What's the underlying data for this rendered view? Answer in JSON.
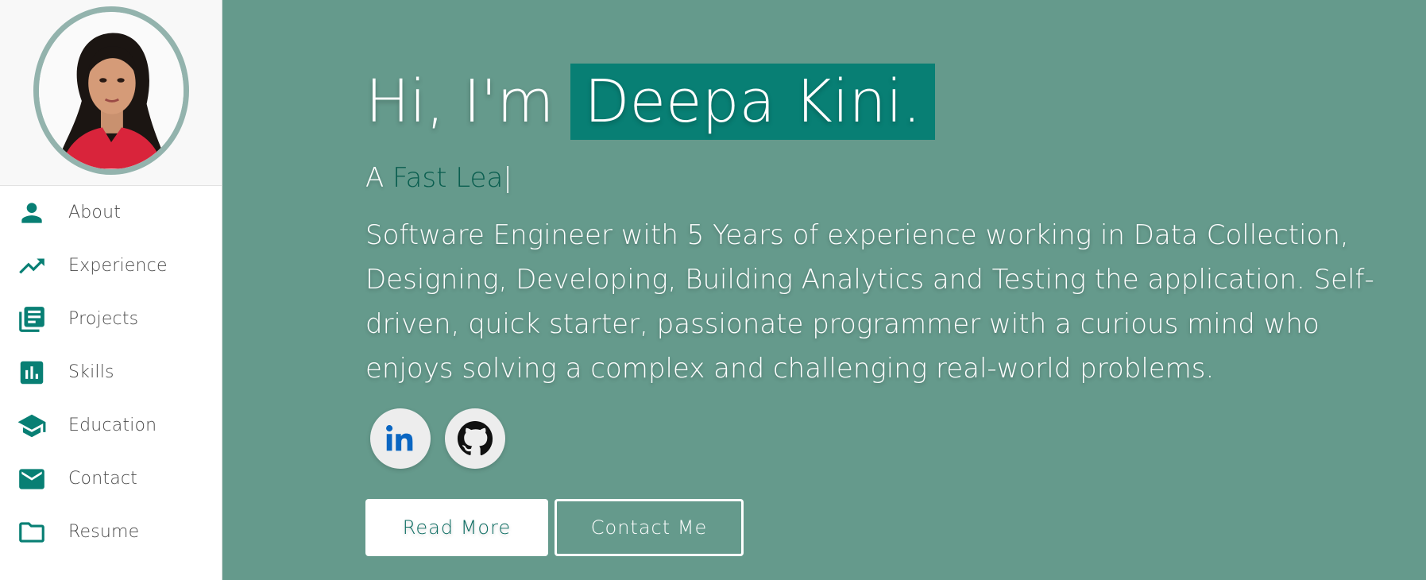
{
  "sidebar": {
    "avatar_alt": "profile photo",
    "items": [
      {
        "label": "About",
        "icon": "person-icon"
      },
      {
        "label": "Experience",
        "icon": "trending-up-icon"
      },
      {
        "label": "Projects",
        "icon": "library-books-icon"
      },
      {
        "label": "Skills",
        "icon": "bar-chart-icon"
      },
      {
        "label": "Education",
        "icon": "graduation-cap-icon"
      },
      {
        "label": "Contact",
        "icon": "mail-icon"
      },
      {
        "label": "Resume",
        "icon": "folder-icon"
      }
    ]
  },
  "hero": {
    "greeting_prefix": "Hi, I'm",
    "name": "Deepa Kini.",
    "typed_prefix": "A",
    "typed_word": "Fast Lea",
    "caret": "|",
    "bio": "Software Engineer with 5 Years of experience working in Data Collection, Designing, Developing, Building Analytics and Testing the application. Self-driven, quick starter, passionate programmer with a curious mind who enjoys solving a complex and challenging real-world problems.",
    "social": [
      {
        "name": "linkedin",
        "icon": "linkedin-icon"
      },
      {
        "name": "github",
        "icon": "github-icon"
      }
    ],
    "buttons": {
      "read_more": "Read More",
      "contact_me": "Contact Me"
    }
  },
  "colors": {
    "accent": "#087f74",
    "background": "#659a8c",
    "sidebar": "#ffffff",
    "avatar_border": "#93b3ad"
  }
}
